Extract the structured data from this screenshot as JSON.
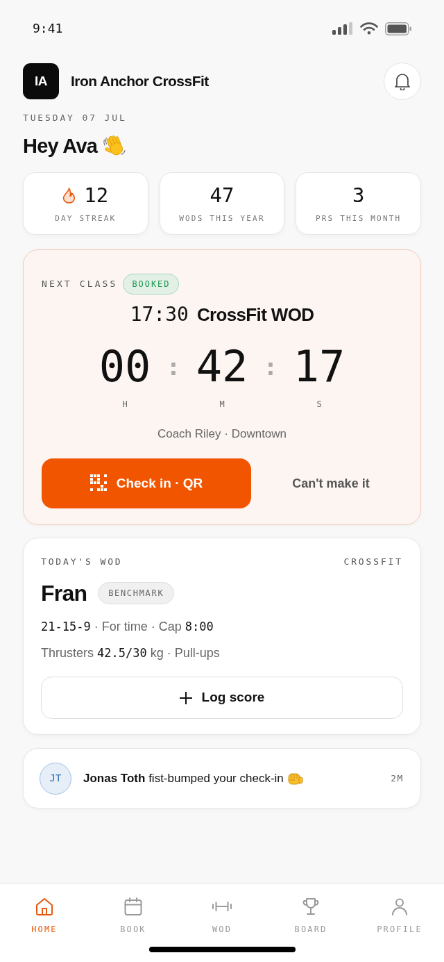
{
  "status_bar": {
    "time": "9:41"
  },
  "header": {
    "logo": "IA",
    "gym_name": "Iron Anchor CrossFit"
  },
  "greeting": {
    "date": "TUESDAY 07 JUL",
    "text": "Hey Ava"
  },
  "stats": [
    {
      "kind": "streak",
      "value": "12",
      "label": "DAY STREAK"
    },
    {
      "kind": "plain",
      "value": "47",
      "label": "WODS THIS YEAR"
    },
    {
      "kind": "plain",
      "value": "3",
      "label": "PRS THIS MONTH"
    }
  ],
  "next_class": {
    "label": "NEXT CLASS",
    "badge": "BOOKED",
    "time": "17:30",
    "name": "CrossFit WOD",
    "countdown": [
      {
        "kind": "unit",
        "value": "00",
        "unit": "H"
      },
      {
        "kind": "separator",
        "value": ":"
      },
      {
        "kind": "unit",
        "value": "42",
        "unit": "M"
      },
      {
        "kind": "separator",
        "value": ":"
      },
      {
        "kind": "unit",
        "value": "17",
        "unit": "S"
      }
    ],
    "details": "Coach Riley · Downtown",
    "primary_action": "Check in · QR",
    "secondary_action": "Can't make it"
  },
  "wod": {
    "label": "TODAY'S WOD",
    "category": "CROSSFIT",
    "name": "Fran",
    "badge": "BENCHMARK",
    "lines": [
      {
        "segments": [
          {
            "kind": "mono",
            "text": "21-15-9"
          },
          {
            "kind": "text",
            "text": " · For time · Cap "
          },
          {
            "kind": "mono",
            "text": "8:00"
          }
        ]
      },
      {
        "segments": [
          {
            "kind": "text",
            "text": "Thrusters "
          },
          {
            "kind": "mono",
            "text": "42.5/30"
          },
          {
            "kind": "text",
            "text": " kg · Pull-ups"
          }
        ]
      }
    ],
    "action": "Log score"
  },
  "activity": [
    {
      "initials": "JT",
      "text": "**Jonas Toth** fist-bumped your check-in",
      "time": "2M"
    }
  ],
  "tab_bar": [
    {
      "kind": "home",
      "label": "HOME",
      "selected": true
    },
    {
      "kind": "book",
      "label": "BOOK",
      "selected": false
    },
    {
      "kind": "wod",
      "label": "WOD",
      "selected": false
    },
    {
      "kind": "board",
      "label": "BOARD",
      "selected": false
    },
    {
      "kind": "profile",
      "label": "PROFILE",
      "selected": false
    }
  ]
}
